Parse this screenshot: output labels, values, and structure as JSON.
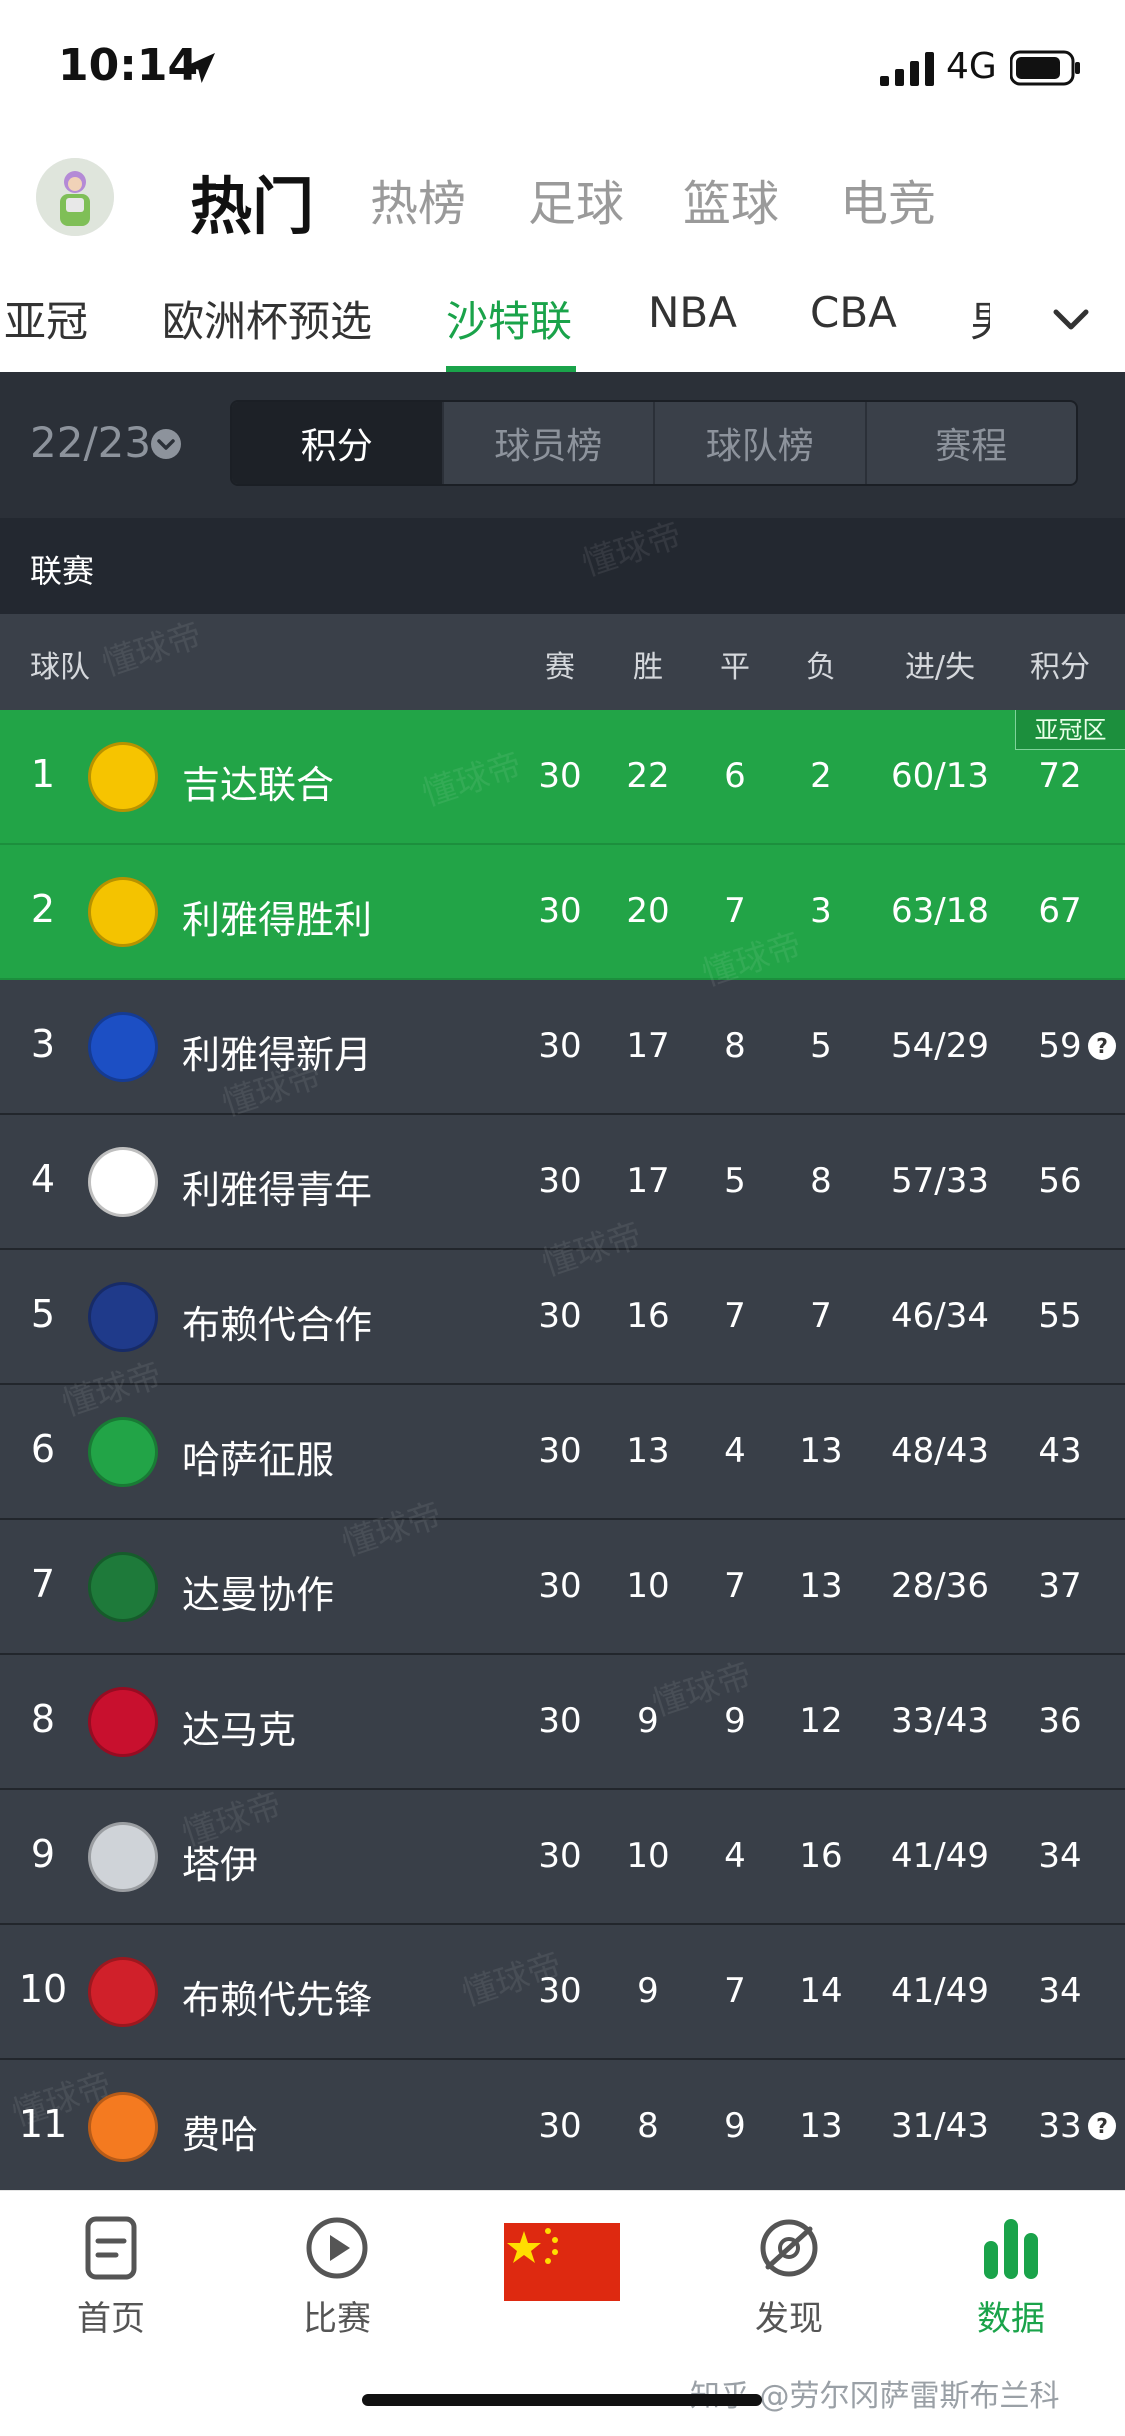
{
  "status_bar": {
    "time": "10:14",
    "network": "4G"
  },
  "top_nav": {
    "tabs": [
      {
        "label": "热门",
        "active": true
      },
      {
        "label": "热榜",
        "active": false
      },
      {
        "label": "足球",
        "active": false
      },
      {
        "label": "篮球",
        "active": false
      },
      {
        "label": "电竞",
        "active": false
      }
    ]
  },
  "sub_tabs": {
    "items": [
      {
        "label": "亚冠",
        "active": false
      },
      {
        "label": "欧洲杯预选",
        "active": false
      },
      {
        "label": "沙特联",
        "active": true
      },
      {
        "label": "NBA",
        "active": false
      },
      {
        "label": "CBA",
        "active": false
      },
      {
        "label": "男篮",
        "active": false
      }
    ]
  },
  "season": {
    "label": "22/23"
  },
  "segments": [
    {
      "label": "积分",
      "active": true
    },
    {
      "label": "球员榜",
      "active": false
    },
    {
      "label": "球队榜",
      "active": false
    },
    {
      "label": "赛程",
      "active": false
    }
  ],
  "league": {
    "label": "联赛"
  },
  "table": {
    "headers": {
      "team": "球队",
      "played": "赛",
      "won": "胜",
      "drawn": "平",
      "lost": "负",
      "goals": "进/失",
      "points": "积分"
    },
    "zone_tag": "亚冠区",
    "rows": [
      {
        "rank": "1",
        "team": "吉达联合",
        "played": "30",
        "won": "22",
        "drawn": "6",
        "lost": "2",
        "goals": "60/13",
        "points": "72",
        "zone": "green",
        "logo_color": "#f6c400",
        "help": false
      },
      {
        "rank": "2",
        "team": "利雅得胜利",
        "played": "30",
        "won": "20",
        "drawn": "7",
        "lost": "3",
        "goals": "63/18",
        "points": "67",
        "zone": "green",
        "logo_color": "#f4c300",
        "help": false
      },
      {
        "rank": "3",
        "team": "利雅得新月",
        "played": "30",
        "won": "17",
        "drawn": "8",
        "lost": "5",
        "goals": "54/29",
        "points": "59",
        "zone": "none",
        "logo_color": "#1c4fc4",
        "help": true
      },
      {
        "rank": "4",
        "team": "利雅得青年",
        "played": "30",
        "won": "17",
        "drawn": "5",
        "lost": "8",
        "goals": "57/33",
        "points": "56",
        "zone": "none",
        "logo_color": "#ffffff",
        "help": false
      },
      {
        "rank": "5",
        "team": "布赖代合作",
        "played": "30",
        "won": "16",
        "drawn": "7",
        "lost": "7",
        "goals": "46/34",
        "points": "55",
        "zone": "none",
        "logo_color": "#1f3a8a",
        "help": false
      },
      {
        "rank": "6",
        "team": "哈萨征服",
        "played": "30",
        "won": "13",
        "drawn": "4",
        "lost": "13",
        "goals": "48/43",
        "points": "43",
        "zone": "none",
        "logo_color": "#22a447",
        "help": false
      },
      {
        "rank": "7",
        "team": "达曼协作",
        "played": "30",
        "won": "10",
        "drawn": "7",
        "lost": "13",
        "goals": "28/36",
        "points": "37",
        "zone": "none",
        "logo_color": "#1e7a3a",
        "help": false
      },
      {
        "rank": "8",
        "team": "达马克",
        "played": "30",
        "won": "9",
        "drawn": "9",
        "lost": "12",
        "goals": "33/43",
        "points": "36",
        "zone": "none",
        "logo_color": "#c8102e",
        "help": false
      },
      {
        "rank": "9",
        "team": "塔伊",
        "played": "30",
        "won": "10",
        "drawn": "4",
        "lost": "16",
        "goals": "41/49",
        "points": "34",
        "zone": "none",
        "logo_color": "#cfd3d8",
        "help": false
      },
      {
        "rank": "10",
        "team": "布赖代先锋",
        "played": "30",
        "won": "9",
        "drawn": "7",
        "lost": "14",
        "goals": "41/49",
        "points": "34",
        "zone": "none",
        "logo_color": "#d0202a",
        "help": false
      },
      {
        "rank": "11",
        "team": "费哈",
        "played": "30",
        "won": "8",
        "drawn": "9",
        "lost": "13",
        "goals": "31/43",
        "points": "33",
        "zone": "none",
        "logo_color": "#f47a20",
        "help": true
      }
    ]
  },
  "watermark_text": "懂球帝",
  "bottom_tabs": [
    {
      "label": "首页",
      "icon": "document-icon",
      "active": false
    },
    {
      "label": "比赛",
      "icon": "play-icon",
      "active": false
    },
    {
      "label": "",
      "icon": "china-flag-icon",
      "active": false
    },
    {
      "label": "发现",
      "icon": "compass-icon",
      "active": false
    },
    {
      "label": "数据",
      "icon": "bar-data-icon",
      "active": true
    }
  ],
  "credit": "知乎 @劳尔冈萨雷斯布兰科",
  "colors": {
    "accent_green": "#1aa34a",
    "zone_green": "#22a447",
    "dark_bg": "#2b3038",
    "row_bg": "#393f48"
  }
}
